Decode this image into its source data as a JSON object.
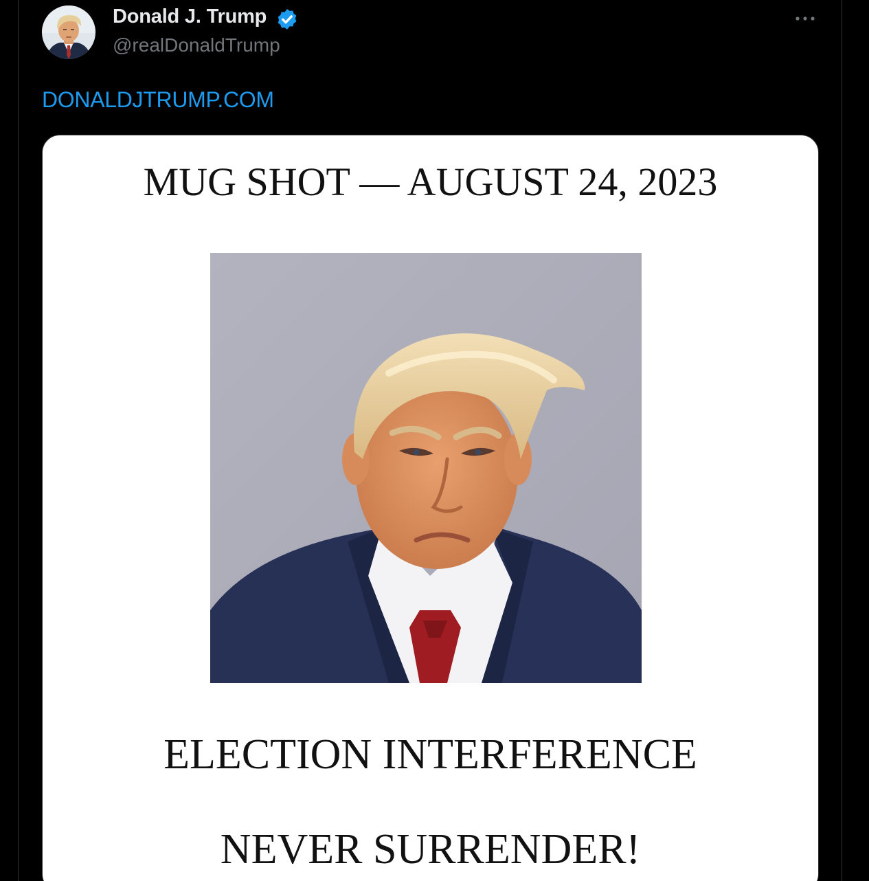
{
  "post": {
    "author": {
      "name": "Donald J. Trump",
      "handle": "@realDonaldTrump",
      "verified": true,
      "verified_icon": "verified-badge-icon",
      "avatar_icon": "avatar-photo"
    },
    "more_icon": "more-horizontal-icon",
    "link_text": "DONALDJTRUMP.COM",
    "media": {
      "title": "MUG SHOT — AUGUST 24, 2023",
      "photo": "mugshot-photo",
      "line1": "ELECTION INTERFERENCE",
      "line2": "NEVER SURRENDER!"
    }
  },
  "colors": {
    "background": "#000000",
    "name_text": "#e7e9ea",
    "handle_text": "#71767b",
    "link": "#1d9bf0",
    "verified": "#1d9bf0",
    "card_background": "#ffffff",
    "border": "#2f3336"
  }
}
